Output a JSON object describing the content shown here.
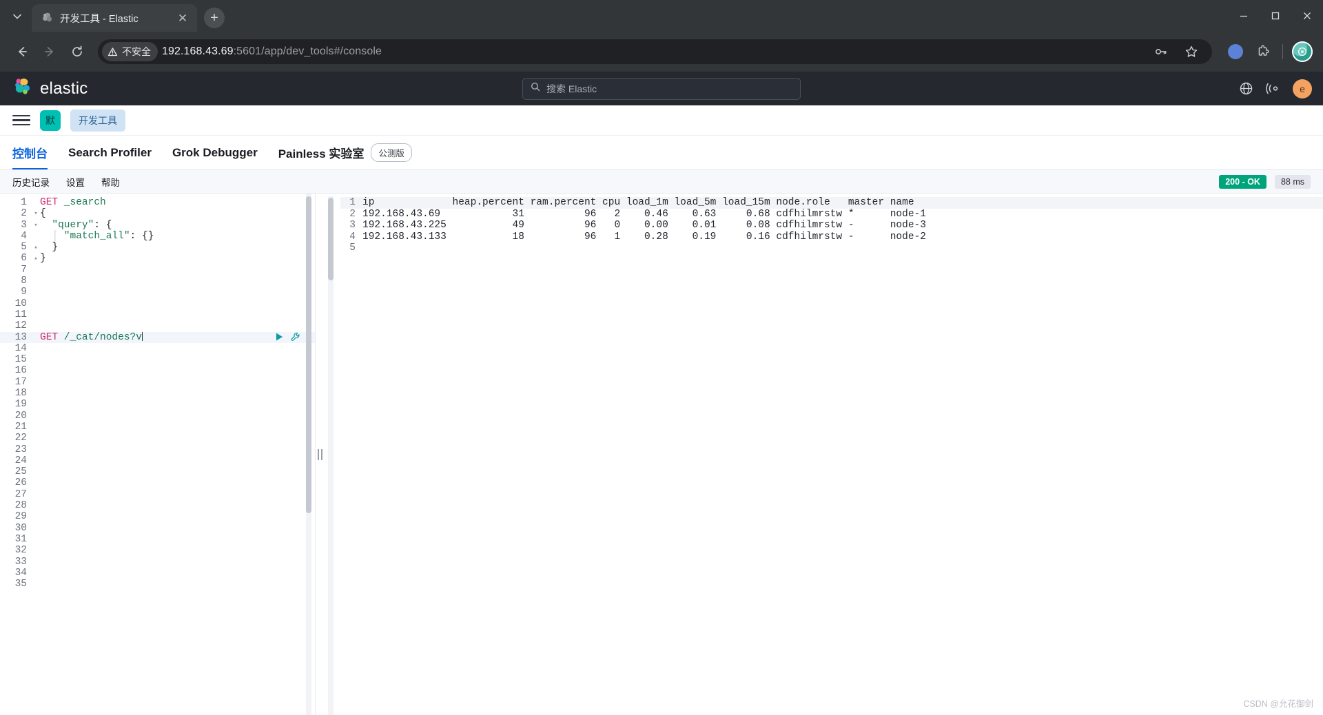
{
  "browser": {
    "tab_title": "开发工具 - Elastic",
    "tab_close_glyph": "✕",
    "new_tab_glyph": "+",
    "security_label": "不安全",
    "security_glyph": "⚠",
    "url_host": "192.168.43.69",
    "url_path": ":5601/app/dev_tools#/console",
    "minimize_glyph": "—",
    "maximize_glyph": "▢",
    "close_glyph": "✕",
    "back_glyph": "←",
    "forward_glyph": "→",
    "reload_glyph": "⟳"
  },
  "header": {
    "brand": "elastic",
    "search_placeholder": "搜索 Elastic",
    "search_icon_glyph": "○",
    "user_initial": "e"
  },
  "breadcrumb": {
    "space_badge": "默",
    "current": "开发工具"
  },
  "app_tabs": [
    {
      "label": "控制台",
      "active": true
    },
    {
      "label": "Search Profiler",
      "active": false
    },
    {
      "label": "Grok Debugger",
      "active": false
    },
    {
      "label": "Painless 实验室",
      "active": false,
      "badge": "公测版"
    }
  ],
  "console_toolbar": {
    "history": "历史记录",
    "settings": "设置",
    "help": "帮助",
    "status_code": "200 - OK",
    "duration": "88 ms"
  },
  "editor": {
    "total_lines": 35,
    "active_line": 13,
    "lines": [
      {
        "n": 1,
        "fold": "",
        "segments": [
          {
            "t": "GET",
            "c": "tok-method"
          },
          {
            "t": " _search",
            "c": "tok-url"
          }
        ]
      },
      {
        "n": 2,
        "fold": "▾",
        "segments": [
          {
            "t": "{",
            "c": "tok-punct"
          }
        ]
      },
      {
        "n": 3,
        "fold": "▾",
        "segments": [
          {
            "t": "  \"query\"",
            "c": "tok-key"
          },
          {
            "t": ": {",
            "c": "tok-punct"
          }
        ]
      },
      {
        "n": 4,
        "fold": "",
        "segments": [
          {
            "t": "  ",
            "c": "tok-punct"
          },
          {
            "t": "│",
            "c": "tok-guide"
          },
          {
            "t": " \"match_all\"",
            "c": "tok-key"
          },
          {
            "t": ": {}",
            "c": "tok-punct"
          }
        ]
      },
      {
        "n": 5,
        "fold": "▴",
        "segments": [
          {
            "t": "  }",
            "c": "tok-punct"
          }
        ]
      },
      {
        "n": 6,
        "fold": "▴",
        "segments": [
          {
            "t": "}",
            "c": "tok-punct"
          }
        ]
      },
      {
        "n": 7,
        "fold": "",
        "segments": []
      },
      {
        "n": 8,
        "fold": "",
        "segments": []
      },
      {
        "n": 9,
        "fold": "",
        "segments": []
      },
      {
        "n": 10,
        "fold": "",
        "segments": []
      },
      {
        "n": 11,
        "fold": "",
        "segments": []
      },
      {
        "n": 12,
        "fold": "",
        "segments": []
      },
      {
        "n": 13,
        "fold": "",
        "segments": [
          {
            "t": "GET",
            "c": "tok-method"
          },
          {
            "t": " /_cat/nodes?v",
            "c": "tok-url"
          }
        ],
        "active": true,
        "caret": true
      },
      {
        "n": 14,
        "fold": "",
        "segments": []
      },
      {
        "n": 15,
        "fold": "",
        "segments": []
      },
      {
        "n": 16,
        "fold": "",
        "segments": []
      },
      {
        "n": 17,
        "fold": "",
        "segments": []
      },
      {
        "n": 18,
        "fold": "",
        "segments": []
      },
      {
        "n": 19,
        "fold": "",
        "segments": []
      },
      {
        "n": 20,
        "fold": "",
        "segments": []
      },
      {
        "n": 21,
        "fold": "",
        "segments": []
      },
      {
        "n": 22,
        "fold": "",
        "segments": []
      },
      {
        "n": 23,
        "fold": "",
        "segments": []
      },
      {
        "n": 24,
        "fold": "",
        "segments": []
      },
      {
        "n": 25,
        "fold": "",
        "segments": []
      },
      {
        "n": 26,
        "fold": "",
        "segments": []
      },
      {
        "n": 27,
        "fold": "",
        "segments": []
      },
      {
        "n": 28,
        "fold": "",
        "segments": []
      },
      {
        "n": 29,
        "fold": "",
        "segments": []
      },
      {
        "n": 30,
        "fold": "",
        "segments": []
      },
      {
        "n": 31,
        "fold": "",
        "segments": []
      },
      {
        "n": 32,
        "fold": "",
        "segments": []
      },
      {
        "n": 33,
        "fold": "",
        "segments": []
      },
      {
        "n": 34,
        "fold": "",
        "segments": []
      },
      {
        "n": 35,
        "fold": "",
        "segments": []
      }
    ]
  },
  "output": {
    "lines": [
      {
        "n": 1,
        "text": "ip             heap.percent ram.percent cpu load_1m load_5m load_15m node.role   master name",
        "header": true
      },
      {
        "n": 2,
        "text": "192.168.43.69            31          96   2    0.46    0.63     0.68 cdfhilmrstw *      node-1"
      },
      {
        "n": 3,
        "text": "192.168.43.225           49          96   0    0.00    0.01     0.08 cdfhilmrstw -      node-3"
      },
      {
        "n": 4,
        "text": "192.168.43.133           18          96   1    0.28    0.19     0.16 cdfhilmrstw -      node-2"
      },
      {
        "n": 5,
        "text": ""
      }
    ],
    "table": {
      "columns": [
        "ip",
        "heap.percent",
        "ram.percent",
        "cpu",
        "load_1m",
        "load_5m",
        "load_15m",
        "node.role",
        "master",
        "name"
      ],
      "rows": [
        [
          "192.168.43.69",
          "31",
          "96",
          "2",
          "0.46",
          "0.63",
          "0.68",
          "cdfhilmrstw",
          "*",
          "node-1"
        ],
        [
          "192.168.43.225",
          "49",
          "96",
          "0",
          "0.00",
          "0.01",
          "0.08",
          "cdfhilmrstw",
          "-",
          "node-3"
        ],
        [
          "192.168.43.133",
          "18",
          "96",
          "1",
          "0.28",
          "0.19",
          "0.16",
          "cdfhilmrstw",
          "-",
          "node-2"
        ]
      ]
    }
  },
  "watermark": "CSDN @允花御剑"
}
